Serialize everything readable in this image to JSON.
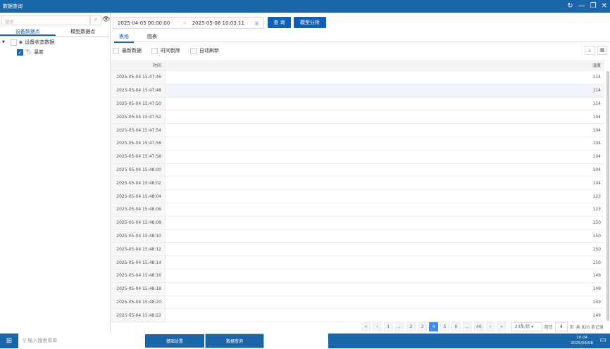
{
  "window": {
    "title": "数据查询"
  },
  "left": {
    "search_placeholder": "搜索",
    "tabs": [
      "设备数据点",
      "模型数据点"
    ],
    "tree": {
      "group": "设备状态数据",
      "item": "温度"
    }
  },
  "query": {
    "start": "2025-04-05 00:00:00",
    "end": "2025-05-08 10:03:11",
    "query_btn": "查 询",
    "model_btn": "模型分析"
  },
  "view_tabs": [
    "表格",
    "图表"
  ],
  "options": [
    "最新数据",
    "时间倒序",
    "自动刷新"
  ],
  "table": {
    "headers": [
      "时间",
      "温度"
    ],
    "rows": [
      [
        "2025-05-04 15:47:46",
        "114"
      ],
      [
        "2025-05-04 15:47:48",
        "114"
      ],
      [
        "2025-05-04 15:47:50",
        "114"
      ],
      [
        "2025-05-04 15:47:52",
        "104"
      ],
      [
        "2025-05-04 15:47:54",
        "104"
      ],
      [
        "2025-05-04 15:47:56",
        "104"
      ],
      [
        "2025-05-04 15:47:58",
        "104"
      ],
      [
        "2025-05-04 15:48:00",
        "104"
      ],
      [
        "2025-05-04 15:48:02",
        "104"
      ],
      [
        "2025-05-04 15:48:04",
        "123"
      ],
      [
        "2025-05-04 15:48:06",
        "123"
      ],
      [
        "2025-05-04 15:48:08",
        "150"
      ],
      [
        "2025-05-04 15:48:10",
        "150"
      ],
      [
        "2025-05-04 15:48:12",
        "150"
      ],
      [
        "2025-05-04 15:48:14",
        "150"
      ],
      [
        "2025-05-04 15:48:16",
        "149"
      ],
      [
        "2025-05-04 15:48:18",
        "149"
      ],
      [
        "2025-05-04 15:48:20",
        "149"
      ],
      [
        "2025-05-04 15:48:22",
        "149"
      ]
    ]
  },
  "pager": {
    "pages": [
      "1",
      "…",
      "2",
      "3",
      "4",
      "5",
      "6",
      "…",
      "46"
    ],
    "current": "4",
    "page_size": "20条/页",
    "goto_label": "前往",
    "goto_value": "4",
    "page_unit": "页",
    "total": "共 920 条记录"
  },
  "taskbar": {
    "search_placeholder": "输入搜索菜单",
    "apps": [
      "基础设置",
      "数据查询"
    ],
    "time": "10:04",
    "date": "2025/05/08"
  }
}
